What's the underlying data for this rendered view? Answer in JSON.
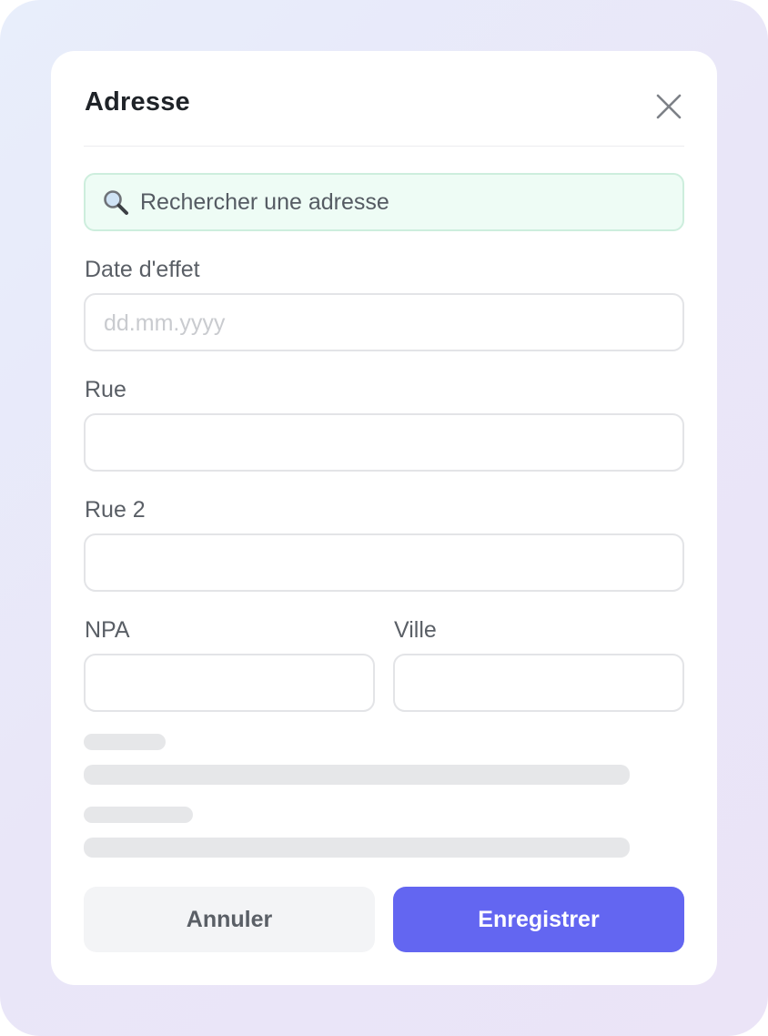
{
  "dialog": {
    "title": "Adresse",
    "close_icon": "close-icon"
  },
  "search": {
    "icon": "search-icon",
    "placeholder": "Rechercher une adresse"
  },
  "fields": {
    "effective_date": {
      "label": "Date d'effet",
      "placeholder": "dd.mm.yyyy",
      "value": ""
    },
    "street": {
      "label": "Rue",
      "value": ""
    },
    "street2": {
      "label": "Rue 2",
      "value": ""
    },
    "zip": {
      "label": "NPA",
      "value": ""
    },
    "city": {
      "label": "Ville",
      "value": ""
    }
  },
  "buttons": {
    "cancel_label": "Annuler",
    "save_label": "Enregistrer"
  },
  "colors": {
    "accent": "#6366f1",
    "search_bg": "#eefcf5",
    "search_border": "#cdeedd"
  }
}
